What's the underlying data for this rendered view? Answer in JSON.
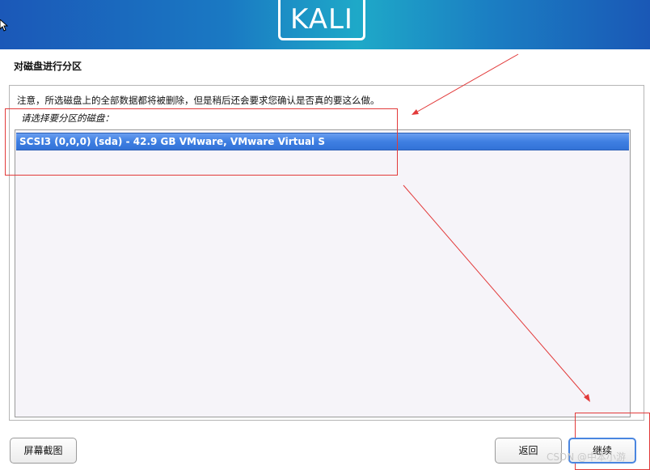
{
  "header": {
    "logo_text": "KALI"
  },
  "step_title": "对磁盘进行分区",
  "note": "注意，所选磁盘上的全部数据都将被删除，但是稍后还会要求您确认是否真的要这么做。",
  "prompt": "请选择要分区的磁盘：",
  "disks": [
    {
      "label": "SCSI3 (0,0,0) (sda) - 42.9 GB VMware, VMware Virtual S",
      "selected": true
    }
  ],
  "buttons": {
    "screenshot": "屏幕截图",
    "back": "返回",
    "continue": "继续"
  },
  "watermark": "CSDN @中本小游",
  "colors": {
    "selection": "#3f7fe2",
    "annotation": "#e23a3a"
  }
}
